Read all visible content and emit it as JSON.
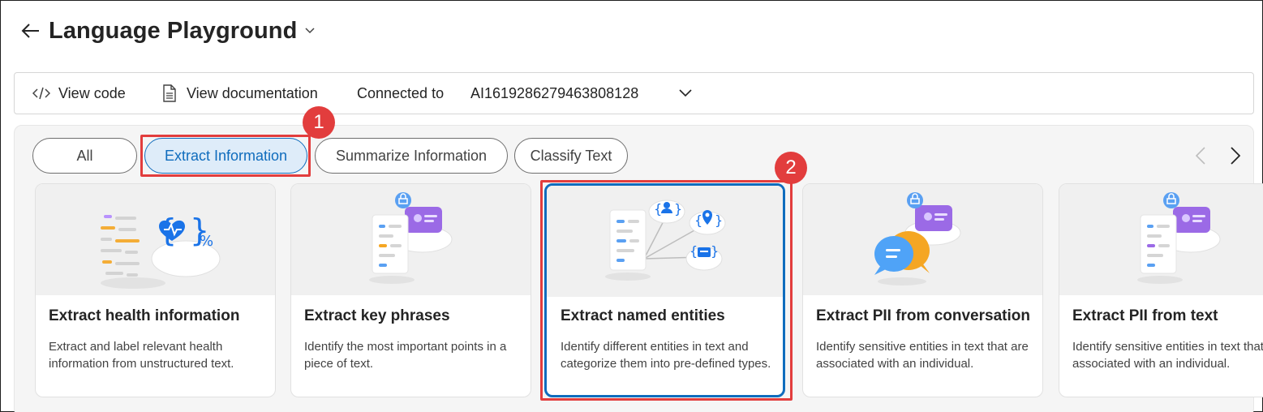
{
  "header": {
    "title": "Language Playground"
  },
  "toolbar": {
    "view_code": "View code",
    "view_documentation": "View documentation",
    "connected_to_label": "Connected to",
    "connected_resource": "AI1619286279463808128"
  },
  "filters": {
    "pills": [
      {
        "label": "All",
        "active": false
      },
      {
        "label": "Extract Information",
        "active": true
      },
      {
        "label": "Summarize Information",
        "active": false
      },
      {
        "label": "Classify Text",
        "active": false
      }
    ]
  },
  "cards": [
    {
      "title": "Extract health information",
      "description": "Extract and label relevant health information from unstructured text.",
      "icon": "health-illustration",
      "selected": false
    },
    {
      "title": "Extract key phrases",
      "description": "Identify the most important points in a piece of text.",
      "icon": "key-phrases-illustration",
      "selected": false
    },
    {
      "title": "Extract named entities",
      "description": "Identify different entities in text and categorize them into pre-defined types.",
      "icon": "named-entities-illustration",
      "selected": true
    },
    {
      "title": "Extract PII from conversation",
      "description": "Identify sensitive entities in text that are associated with an individual.",
      "icon": "pii-conversation-illustration",
      "selected": false
    },
    {
      "title": "Extract PII from text",
      "description": "Identify sensitive entities in text that are associated with an individual.",
      "icon": "pii-text-illustration",
      "selected": false
    }
  ],
  "callouts": [
    {
      "number": "1"
    },
    {
      "number": "2"
    }
  ],
  "colors": {
    "accent": "#0f6cbd",
    "callout": "#e23d3d",
    "purple": "#8a4fd9",
    "orange": "#f5a623"
  }
}
